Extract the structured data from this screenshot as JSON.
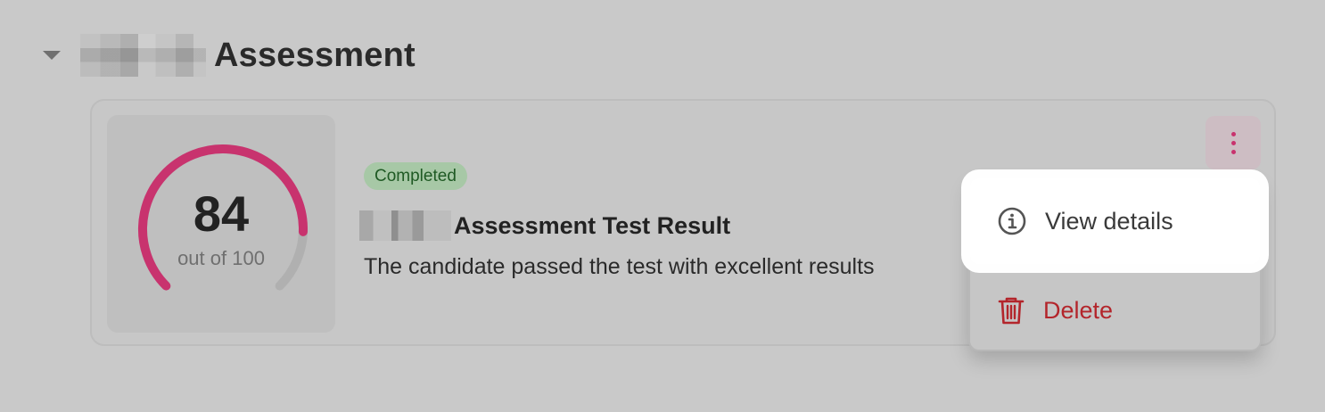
{
  "section": {
    "title": "Assessment",
    "caret_icon": "caret-down-icon"
  },
  "card": {
    "score": {
      "value": "84",
      "out_of": "out of 100",
      "fraction": 0.84,
      "accent": "#c8336e",
      "track": "#b0b0b0"
    },
    "badge": "Completed",
    "title": "Assessment Test Result",
    "description": "The candidate passed the test with excellent results",
    "menu_icon": "more-vertical-icon"
  },
  "menu": {
    "items": [
      {
        "label": "View details",
        "icon": "info-icon"
      },
      {
        "label": "Delete",
        "icon": "trash-icon",
        "color": "#b3252b"
      }
    ]
  }
}
